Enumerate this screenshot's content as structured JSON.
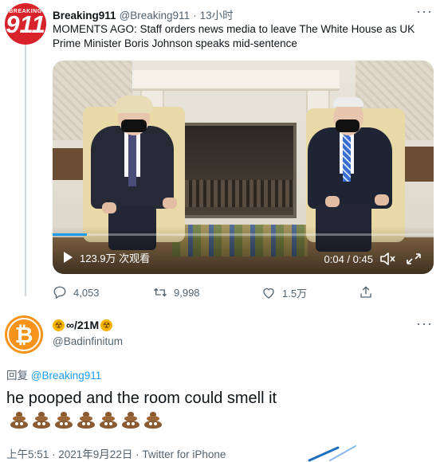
{
  "parent_tweet": {
    "avatar_top_text": "BREAKING",
    "avatar_main_text": "911",
    "display_name": "Breaking911",
    "handle": "@Breaking911",
    "separator": "·",
    "time": "13小时",
    "text": "MOMENTS AGO: Staff orders news media to leave The White House as UK Prime Minister Boris Johnson speaks mid-sentence",
    "video": {
      "views": "123.9万 次观看",
      "time": "0:04 / 0:45",
      "progress": 0.09
    },
    "actions": {
      "replies": "4,053",
      "retweets": "9,998",
      "likes": "1.5万"
    }
  },
  "reply_tweet": {
    "avatar_symbol": "₿",
    "display_name": "∞/21M",
    "name_icon": "☢",
    "handle": "@Badinfinitum",
    "replying_prefix": "回复 ",
    "replying_to": "@Breaking911",
    "text": "he pooped and the room could smell it",
    "poop_emoji_count": 7,
    "meta": "上午5:51 · 2021年9月22日 · Twitter for iPhone"
  },
  "colors": {
    "accent": "#1d9bf0",
    "secondary_text": "#536471",
    "brand_red": "#d8232a",
    "bitcoin_orange": "#f7931a"
  },
  "icons": [
    "more-icon",
    "play-icon",
    "mute-icon",
    "fullscreen-icon",
    "reply-icon",
    "retweet-icon",
    "like-icon",
    "share-icon",
    "hazard-icon",
    "bitcoin-icon",
    "poop-emoji-icon"
  ]
}
